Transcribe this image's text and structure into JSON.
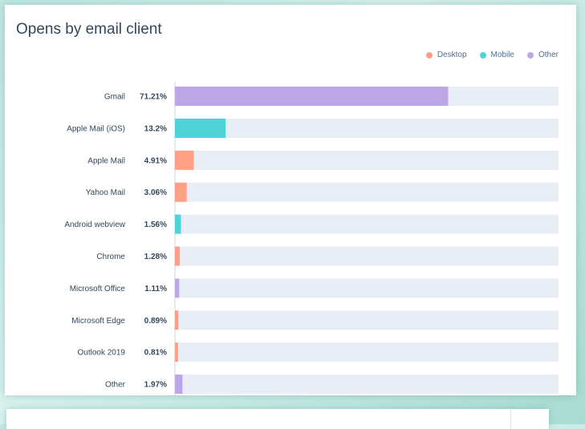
{
  "chart_data": {
    "type": "bar",
    "title": "Opens by email client",
    "orientation": "horizontal",
    "legend": {
      "position": "top-right",
      "items": [
        {
          "name": "Desktop",
          "color": "#ff9f84"
        },
        {
          "name": "Mobile",
          "color": "#4fd2d8"
        },
        {
          "name": "Other",
          "color": "#bda6e8"
        }
      ]
    },
    "track_color": "#e9edf6",
    "xlim": [
      0,
      100
    ],
    "categories": [
      "Gmail",
      "Apple Mail (iOS)",
      "Apple Mail",
      "Yahoo Mail",
      "Android webview",
      "Chrome",
      "Microsoft Office",
      "Microsoft Edge",
      "Outlook 2019",
      "Other"
    ],
    "values": [
      71.21,
      13.2,
      4.91,
      3.06,
      1.56,
      1.28,
      1.11,
      0.89,
      0.81,
      1.97
    ],
    "value_labels": [
      "71.21%",
      "13.2%",
      "4.91%",
      "3.06%",
      "1.56%",
      "1.28%",
      "1.11%",
      "0.89%",
      "0.81%",
      "1.97%"
    ],
    "groups": [
      "Other",
      "Mobile",
      "Desktop",
      "Desktop",
      "Mobile",
      "Desktop",
      "Other",
      "Desktop",
      "Desktop",
      "Other"
    ]
  }
}
